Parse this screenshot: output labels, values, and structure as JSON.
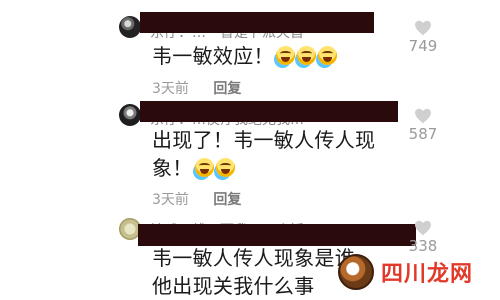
{
  "comments": [
    {
      "name_ghost": "东仔：…一替是卜派天首",
      "text": "韦一敏效应！",
      "emojis": 3,
      "time": "3天前",
      "reply": "回复",
      "likes": "749"
    },
    {
      "name_ghost": "东仔：…侯疗我绝无我…",
      "text_line1": "出现了！韦一敏人传人现",
      "text_line2": "象！",
      "emojis": 2,
      "time": "3天前",
      "reply": "回复",
      "likes": "587"
    },
    {
      "name_ghost": "地球用线死而我…一个插",
      "text_line1": "韦一敏人传人现象是谁",
      "text_line2": "他出现关我什么事",
      "likes": "338"
    }
  ],
  "watermark": {
    "text": "四川龙网"
  },
  "colors": {
    "redaction": "#2a0a0a",
    "meta": "#9a9a9a",
    "watermark": "#e23a2a"
  }
}
